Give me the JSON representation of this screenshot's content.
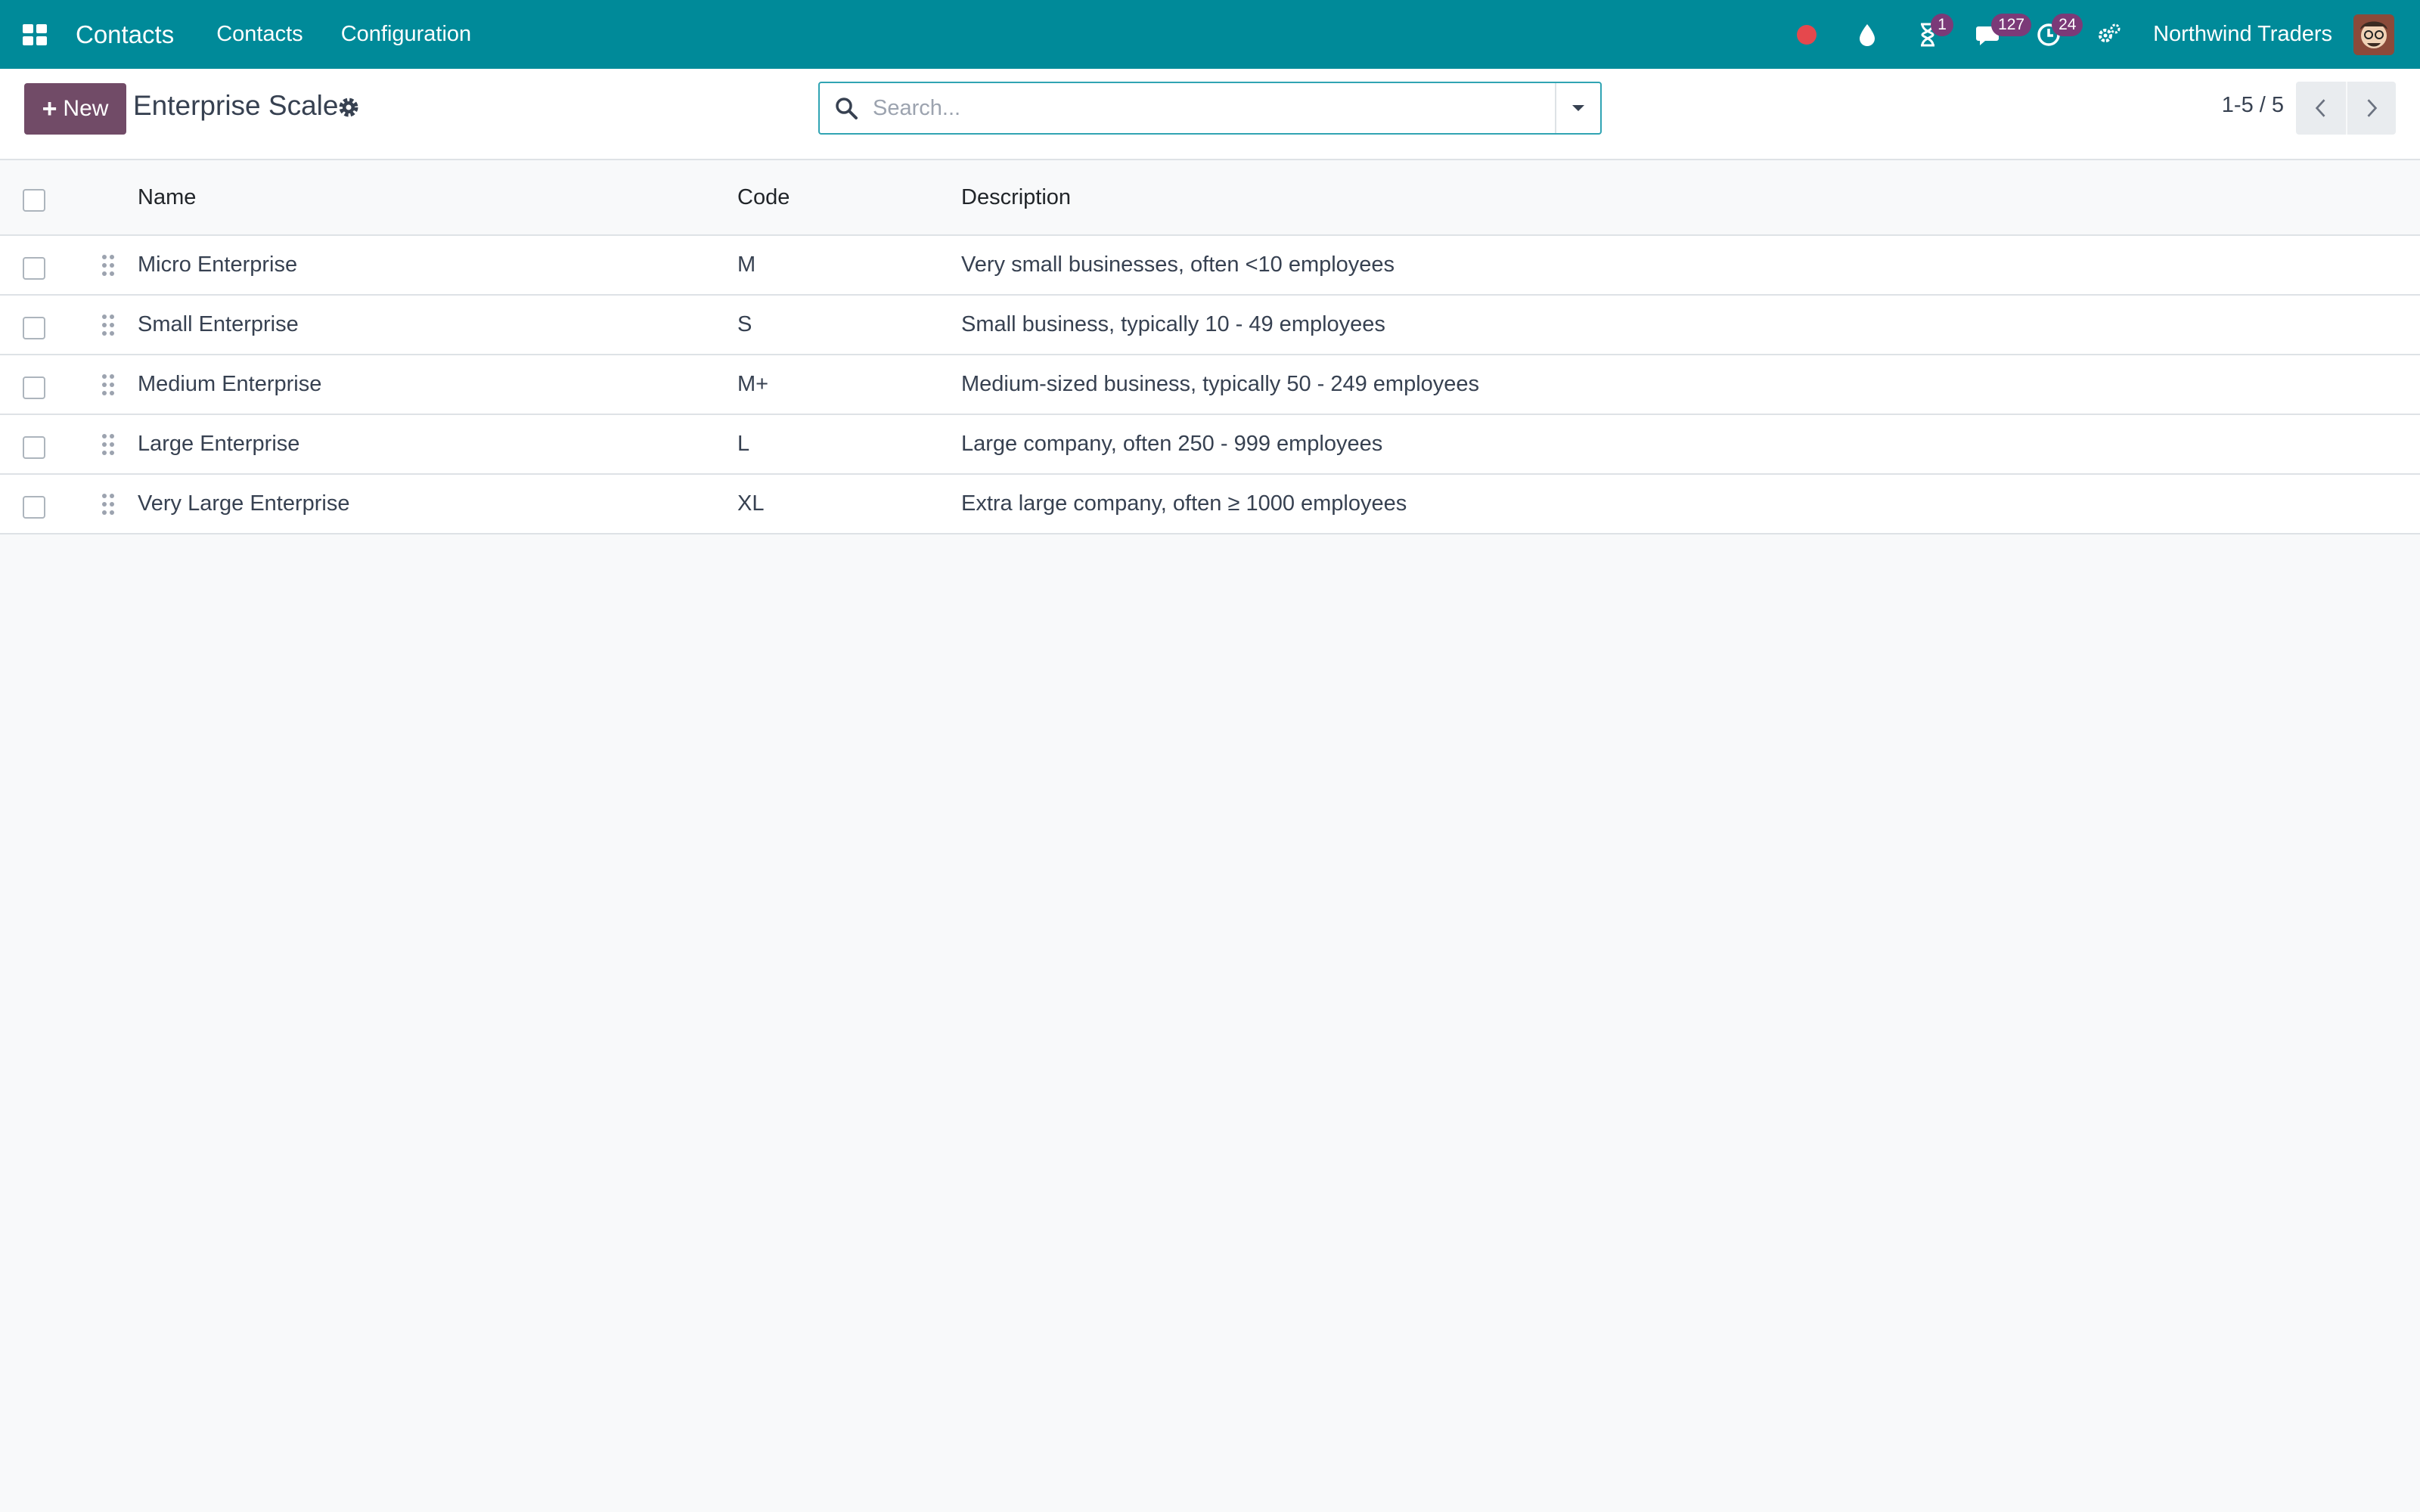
{
  "navbar": {
    "app_name": "Contacts",
    "menus": [
      "Contacts",
      "Configuration"
    ],
    "badges": {
      "activity": "1",
      "messages": "127",
      "reminders": "24"
    },
    "company": "Northwind Traders"
  },
  "control_panel": {
    "new_label": "New",
    "title": "Enterprise Scale",
    "search_placeholder": "Search...",
    "pager": "1-5 / 5"
  },
  "table": {
    "headers": {
      "name": "Name",
      "code": "Code",
      "description": "Description"
    },
    "rows": [
      {
        "name": "Micro Enterprise",
        "code": "M",
        "description": "Very small businesses, often <10 employees"
      },
      {
        "name": "Small Enterprise",
        "code": "S",
        "description": "Small business, typically 10 - 49 employees"
      },
      {
        "name": "Medium Enterprise",
        "code": "M+",
        "description": "Medium-sized business, typically 50 - 249 employees"
      },
      {
        "name": "Large Enterprise",
        "code": "L",
        "description": "Large company, often 250 - 999 employees"
      },
      {
        "name": "Very Large Enterprise",
        "code": "XL",
        "description": "Extra large company, often ≥ 1000 employees"
      }
    ]
  },
  "colors": {
    "navbar": "#008a99",
    "primary": "#714b67",
    "badge": "#7b3a78",
    "recording": "#e5484d"
  },
  "icons": [
    "apps-grid-icon",
    "recording-dot-icon",
    "drop-icon",
    "hourglass-icon",
    "chat-icon",
    "clock-icon",
    "settings-icon",
    "gear-icon",
    "search-icon",
    "caret-down-icon",
    "chevron-left-icon",
    "chevron-right-icon",
    "drag-handle-icon"
  ]
}
